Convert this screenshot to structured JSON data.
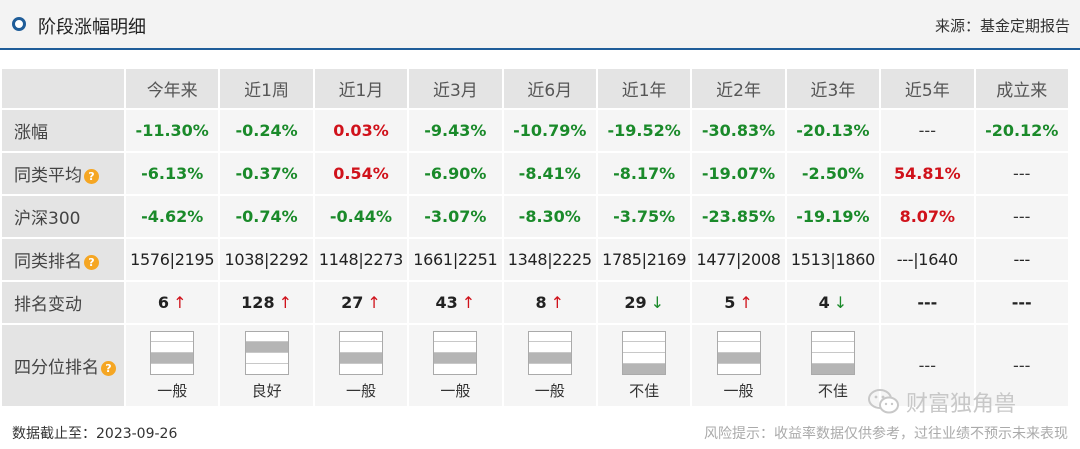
{
  "header": {
    "title": "阶段涨幅明细",
    "source": "来源：基金定期报告"
  },
  "columns": [
    "今年来",
    "近1周",
    "近1月",
    "近3月",
    "近6月",
    "近1年",
    "近2年",
    "近3年",
    "近5年",
    "成立来"
  ],
  "rows": {
    "gain": {
      "label": "涨幅",
      "values": [
        {
          "v": "-11.30%",
          "c": "green"
        },
        {
          "v": "-0.24%",
          "c": "green"
        },
        {
          "v": "0.03%",
          "c": "red"
        },
        {
          "v": "-9.43%",
          "c": "green"
        },
        {
          "v": "-10.79%",
          "c": "green"
        },
        {
          "v": "-19.52%",
          "c": "green"
        },
        {
          "v": "-30.83%",
          "c": "green"
        },
        {
          "v": "-20.13%",
          "c": "green"
        },
        {
          "v": "---",
          "c": "plain"
        },
        {
          "v": "-20.12%",
          "c": "green"
        }
      ]
    },
    "peer_avg": {
      "label": "同类平均",
      "values": [
        {
          "v": "-6.13%",
          "c": "green"
        },
        {
          "v": "-0.37%",
          "c": "green"
        },
        {
          "v": "0.54%",
          "c": "red"
        },
        {
          "v": "-6.90%",
          "c": "green"
        },
        {
          "v": "-8.41%",
          "c": "green"
        },
        {
          "v": "-8.17%",
          "c": "green"
        },
        {
          "v": "-19.07%",
          "c": "green"
        },
        {
          "v": "-2.50%",
          "c": "green"
        },
        {
          "v": "54.81%",
          "c": "red"
        },
        {
          "v": "---",
          "c": "plain"
        }
      ]
    },
    "hs300": {
      "label": "沪深300",
      "values": [
        {
          "v": "-4.62%",
          "c": "green"
        },
        {
          "v": "-0.74%",
          "c": "green"
        },
        {
          "v": "-0.44%",
          "c": "green"
        },
        {
          "v": "-3.07%",
          "c": "green"
        },
        {
          "v": "-8.30%",
          "c": "green"
        },
        {
          "v": "-3.75%",
          "c": "green"
        },
        {
          "v": "-23.85%",
          "c": "green"
        },
        {
          "v": "-19.19%",
          "c": "green"
        },
        {
          "v": "8.07%",
          "c": "red"
        },
        {
          "v": "---",
          "c": "plain"
        }
      ]
    },
    "peer_rank": {
      "label": "同类排名",
      "values": [
        "1576|2195",
        "1038|2292",
        "1148|2273",
        "1661|2251",
        "1348|2225",
        "1785|2169",
        "1477|2008",
        "1513|1860",
        "---|1640",
        "---"
      ]
    },
    "rank_change": {
      "label": "排名变动",
      "values": [
        {
          "v": "6",
          "dir": "up"
        },
        {
          "v": "128",
          "dir": "up"
        },
        {
          "v": "27",
          "dir": "up"
        },
        {
          "v": "43",
          "dir": "up"
        },
        {
          "v": "8",
          "dir": "up"
        },
        {
          "v": "29",
          "dir": "down"
        },
        {
          "v": "5",
          "dir": "up"
        },
        {
          "v": "4",
          "dir": "down"
        },
        {
          "v": "---",
          "dir": ""
        },
        {
          "v": "---",
          "dir": ""
        }
      ]
    },
    "quartile": {
      "label": "四分位排名",
      "values": [
        {
          "level": 3,
          "text": "一般"
        },
        {
          "level": 2,
          "text": "良好"
        },
        {
          "level": 3,
          "text": "一般"
        },
        {
          "level": 3,
          "text": "一般"
        },
        {
          "level": 3,
          "text": "一般"
        },
        {
          "level": 4,
          "text": "不佳"
        },
        {
          "level": 3,
          "text": "一般"
        },
        {
          "level": 4,
          "text": "不佳"
        },
        {
          "level": 0,
          "text": "---"
        },
        {
          "level": 0,
          "text": "---"
        }
      ]
    }
  },
  "footer": {
    "date_text": "数据截止至：2023-09-26",
    "risk_text": "风险提示：收益率数据仅供参考，过往业绩不预示未来表现"
  },
  "watermark": "财富独角兽",
  "colors": {
    "green": "#1a8a2a",
    "red": "#d0121b",
    "accent": "#1f5d99"
  }
}
